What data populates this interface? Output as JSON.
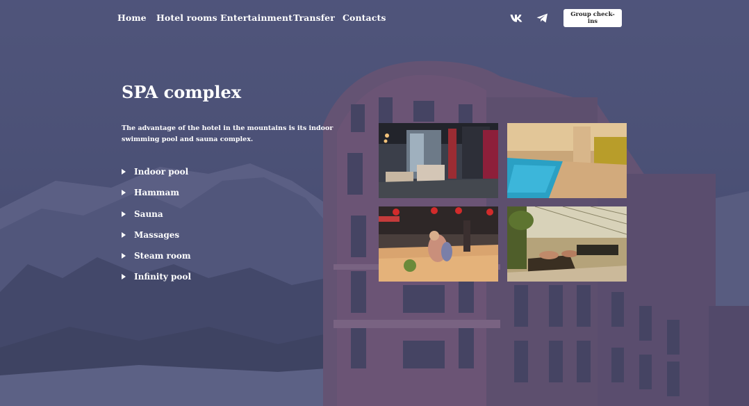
{
  "nav": {
    "links": [
      "Home",
      "Hotel rooms",
      "Entertainment",
      "Transfer",
      "Contacts"
    ],
    "social": [
      "vk-icon",
      "telegram-icon"
    ],
    "checkin_label": "Group check-ins"
  },
  "main": {
    "title": "SPA complex",
    "description": "The advantage of the hotel in the mountains is its indoor swimming pool and sauna complex.",
    "features": [
      "Indoor pool",
      "Hammam",
      "Sauna",
      "Massages",
      "Steam room",
      "Infinity pool"
    ]
  },
  "gallery": {
    "photos": [
      "spa-lobby-photo",
      "indoor-pool-photo",
      "bowling-photo",
      "lounge-pool-photo"
    ]
  },
  "colors": {
    "overlay": "#545a80",
    "text": "#ffffff",
    "button_bg": "#ffffff",
    "button_text": "#222222"
  }
}
